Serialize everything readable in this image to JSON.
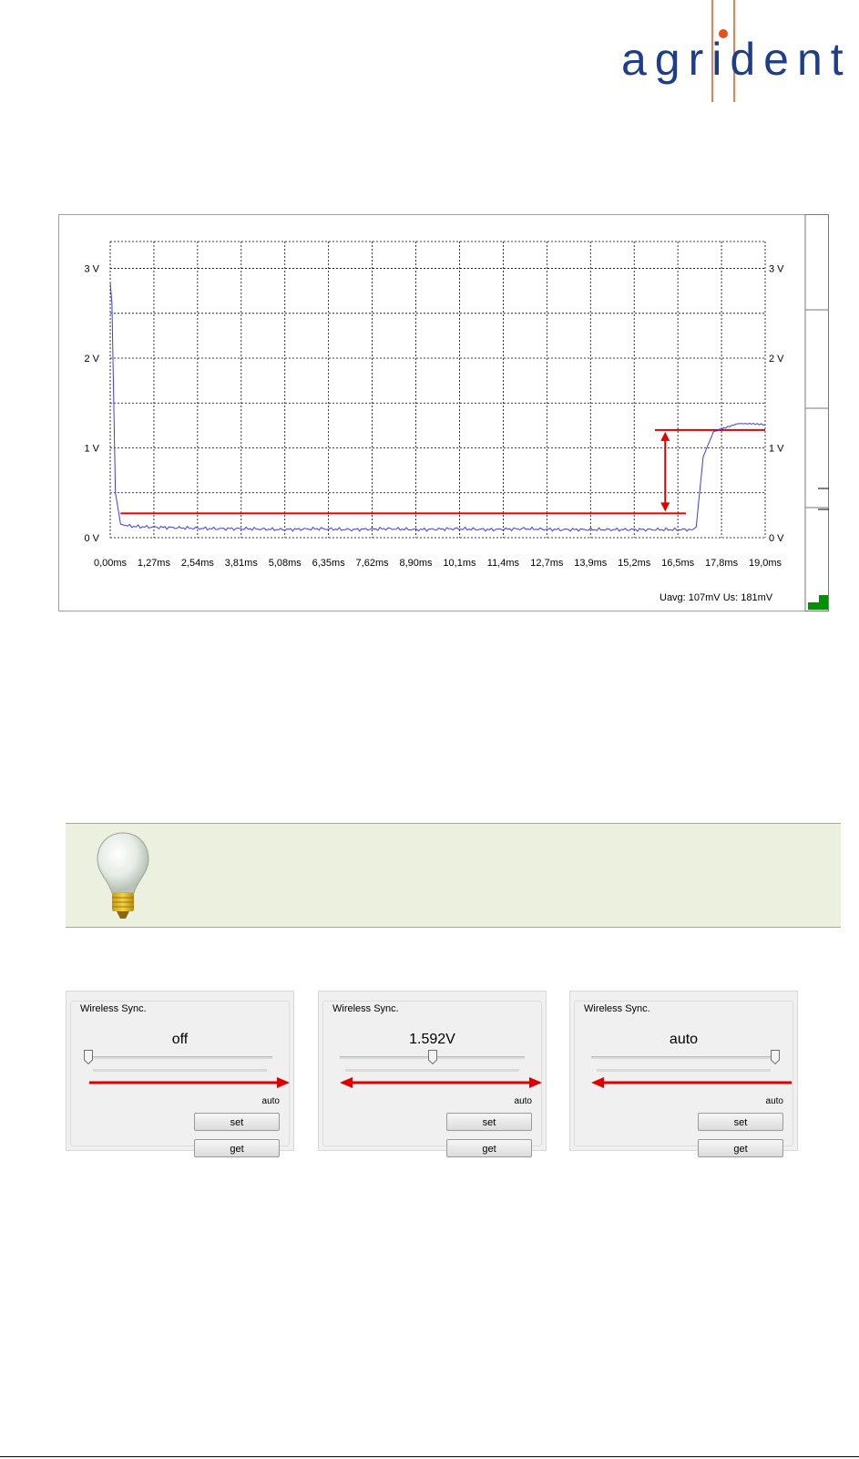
{
  "logo": {
    "text": "agrident"
  },
  "scope": {
    "y_ticks_left": [
      "3 V",
      "2 V",
      "1 V",
      "0 V"
    ],
    "y_ticks_right": [
      "3 V",
      "2 V",
      "1 V",
      "0 V"
    ],
    "x_ticks": [
      "0,00ms",
      "1,27ms",
      "2,54ms",
      "3,81ms",
      "5,08ms",
      "6,35ms",
      "7,62ms",
      "8,90ms",
      "10,1ms",
      "11,4ms",
      "12,7ms",
      "13,9ms",
      "15,2ms",
      "16,5ms",
      "17,8ms",
      "19,0ms"
    ],
    "status": "Uavg: 107mV   Us: 181mV",
    "colors": {
      "trace": "#3a3aff",
      "annotation": "#e00000",
      "grid": "#000000",
      "indicator": "#009000"
    }
  },
  "chart_data": {
    "type": "line",
    "xlabel": "",
    "ylabel": "",
    "xlim": [
      0,
      19.0
    ],
    "ylim": [
      0,
      3.3
    ],
    "x_unit": "ms",
    "y_unit": "V",
    "grid": true,
    "series": [
      {
        "x": [
          0.0,
          0.05,
          0.15,
          0.3,
          0.5,
          1.0,
          2.0,
          3.0,
          4.0,
          5.0,
          6.0,
          7.0,
          8.0,
          9.0,
          10.0,
          11.0,
          12.0,
          13.0,
          14.0,
          15.0,
          16.0,
          16.5,
          16.9,
          17.0,
          17.2,
          17.5,
          17.8,
          18.2,
          18.6,
          19.0
        ],
        "y": [
          2.85,
          2.6,
          0.5,
          0.15,
          0.13,
          0.12,
          0.11,
          0.1,
          0.1,
          0.09,
          0.1,
          0.09,
          0.1,
          0.09,
          0.1,
          0.09,
          0.1,
          0.09,
          0.09,
          0.09,
          0.09,
          0.09,
          0.09,
          0.12,
          0.9,
          1.18,
          1.22,
          1.27,
          1.27,
          1.26
        ]
      }
    ],
    "annotations": {
      "low_level_v": 0.27,
      "high_level_v": 1.2,
      "low_line_x": [
        0.3,
        16.7
      ],
      "high_line_x": [
        15.8,
        19.0
      ],
      "arrow_x": 16.1
    }
  },
  "tip": {
    "icon": "lightbulb-icon"
  },
  "panels": [
    {
      "title": "Wireless Sync.",
      "value": "off",
      "slider_level": 0.0,
      "arrow": "right",
      "auto_label": "auto",
      "set_label": "set",
      "get_label": "get"
    },
    {
      "title": "Wireless Sync.",
      "value": "1.592V",
      "slider_level": 0.5,
      "arrow": "both",
      "auto_label": "auto",
      "set_label": "set",
      "get_label": "get"
    },
    {
      "title": "Wireless Sync.",
      "value": "auto",
      "slider_level": 1.0,
      "arrow": "left",
      "auto_label": "auto",
      "set_label": "set",
      "get_label": "get"
    }
  ]
}
